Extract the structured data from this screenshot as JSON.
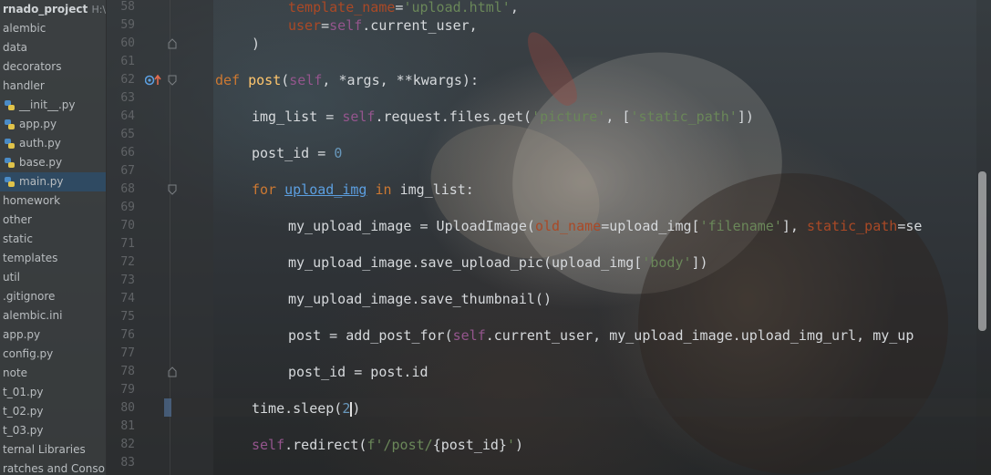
{
  "project": {
    "name": "rnado_project",
    "path": "H:\\T"
  },
  "tree": [
    {
      "label": "alembic",
      "type": "folder"
    },
    {
      "label": "data",
      "type": "folder"
    },
    {
      "label": "decorators",
      "type": "folder"
    },
    {
      "label": "handler",
      "type": "folder"
    },
    {
      "label": "__init__.py",
      "type": "file"
    },
    {
      "label": "app.py",
      "type": "file"
    },
    {
      "label": "auth.py",
      "type": "file"
    },
    {
      "label": "base.py",
      "type": "file"
    },
    {
      "label": "main.py",
      "type": "file",
      "selected": true
    },
    {
      "label": "homework",
      "type": "folder"
    },
    {
      "label": "other",
      "type": "folder"
    },
    {
      "label": "static",
      "type": "folder"
    },
    {
      "label": "templates",
      "type": "folder"
    },
    {
      "label": "util",
      "type": "folder"
    },
    {
      "label": ".gitignore",
      "type": "plain"
    },
    {
      "label": "alembic.ini",
      "type": "plain"
    },
    {
      "label": "app.py",
      "type": "plain"
    },
    {
      "label": "config.py",
      "type": "plain"
    },
    {
      "label": "note",
      "type": "plain"
    },
    {
      "label": "t_01.py",
      "type": "plain"
    },
    {
      "label": "t_02.py",
      "type": "plain"
    },
    {
      "label": "t_03.py",
      "type": "plain"
    },
    {
      "label": "ternal Libraries",
      "type": "plain"
    },
    {
      "label": "ratches and Consoles",
      "type": "plain"
    }
  ],
  "line_numbers": [
    "58",
    "59",
    "60",
    "61",
    "62",
    "63",
    "64",
    "65",
    "66",
    "67",
    "68",
    "69",
    "70",
    "71",
    "72",
    "73",
    "74",
    "75",
    "76",
    "77",
    "78",
    "79",
    "80",
    "81",
    "82",
    "83"
  ],
  "code": {
    "l58": {
      "a": "template_name",
      "b": "=",
      "c": "'upload.html'",
      "d": ","
    },
    "l59": {
      "a": "user",
      "b": "=",
      "c": "self",
      "d": ".current_user,"
    },
    "l60": {
      "a": ")"
    },
    "l62": {
      "kw": "def ",
      "fn": "post",
      "open": "(",
      "self": "self",
      "rest": ", *args, **kwargs):"
    },
    "l64": {
      "a": "img_list = ",
      "self": "self",
      "b": ".request.files.get(",
      "s1": "'picture'",
      "c": ", [",
      "s2": "'static_path'",
      "d": "])"
    },
    "l66": {
      "a": "post_id = ",
      "n": "0"
    },
    "l68": {
      "kw": "for ",
      "var": "upload_img",
      "kw2": " in ",
      "rest": "img_list:"
    },
    "l70": {
      "a": "my_upload_image = UploadImage(",
      "p1": "old_name",
      "b": "=upload_img[",
      "s1": "'filename'",
      "c": "], ",
      "p2": "static_path",
      "d": "=se"
    },
    "l72": {
      "a": "my_upload_image.save_upload_pic(upload_img[",
      "s1": "'body'",
      "b": "])"
    },
    "l74": {
      "a": "my_upload_image.save_thumbnail()"
    },
    "l76": {
      "a": "post = add_post_for(",
      "self": "self",
      "b": ".current_user, my_upload_image.upload_img_url, my_up"
    },
    "l78": {
      "a": "post_id = post.id"
    },
    "l80": {
      "a": "time.sleep(",
      "n": "2",
      "b": ")"
    },
    "l82": {
      "self": "self",
      "a": ".redirect(",
      "s1": "f'/post/",
      "b": "{post_id}",
      "s2": "'",
      "c": ")"
    }
  },
  "colors": {
    "keyword": "#cc7832",
    "function": "#ffc66d",
    "self": "#94558d",
    "string": "#6a8759",
    "number": "#6897bb",
    "param": "#aa4926",
    "selection": "#2f4a62"
  }
}
